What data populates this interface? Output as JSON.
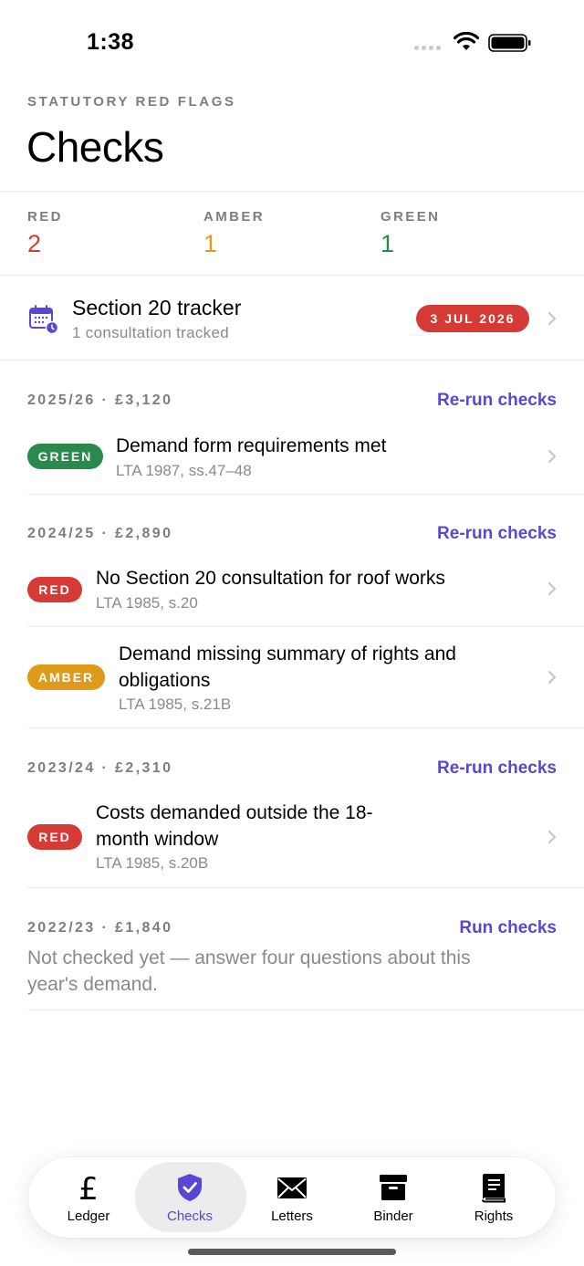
{
  "status_bar": {
    "time": "1:38"
  },
  "header": {
    "eyebrow": "STATUTORY RED FLAGS",
    "title": "Checks"
  },
  "summary": [
    {
      "label": "RED",
      "count": "2",
      "color": "#d63a35"
    },
    {
      "label": "AMBER",
      "count": "1",
      "color": "#de9a1a"
    },
    {
      "label": "GREEN",
      "count": "1",
      "color": "#2a8a4c"
    }
  ],
  "tracker": {
    "title": "Section 20 tracker",
    "subtitle": "1 consultation tracked",
    "badge": "3 JUL 2026",
    "icon": "calendar-clock-icon"
  },
  "years": [
    {
      "heading": "2025/26 · £3,120",
      "action": "Re-run checks",
      "checks": [
        {
          "status": "GREEN",
          "title": "Demand form requirements met",
          "ref": "LTA 1987, ss.47–48"
        }
      ]
    },
    {
      "heading": "2024/25 · £2,890",
      "action": "Re-run checks",
      "checks": [
        {
          "status": "RED",
          "title": "No Section 20 consultation for roof works",
          "ref": "LTA 1985, s.20"
        },
        {
          "status": "AMBER",
          "title_line1": "Demand missing summary of rights and",
          "title_line2": "obligations",
          "ref": "LTA 1985, s.21B"
        }
      ]
    },
    {
      "heading": "2023/24 · £2,310",
      "action": "Re-run checks",
      "checks": [
        {
          "status": "RED",
          "title_line1": "Costs demanded outside the 18-",
          "title_line2": "month window",
          "ref": "LTA 1985, s.20B"
        }
      ]
    },
    {
      "heading": "2022/23 · £1,840",
      "action": "Run checks",
      "note_line1": "Not checked yet — answer four questions about this",
      "note_line2": "year's demand."
    }
  ],
  "tabs": [
    {
      "label": "Ledger",
      "icon": "pound-icon"
    },
    {
      "label": "Checks",
      "icon": "shield-check-icon",
      "active": true
    },
    {
      "label": "Letters",
      "icon": "envelope-icon"
    },
    {
      "label": "Binder",
      "icon": "archive-box-icon"
    },
    {
      "label": "Rights",
      "icon": "book-icon"
    }
  ],
  "colors": {
    "accent": "#5a47d1",
    "red": "#d63a35",
    "amber": "#de9a1a",
    "green": "#2a8a4c"
  }
}
